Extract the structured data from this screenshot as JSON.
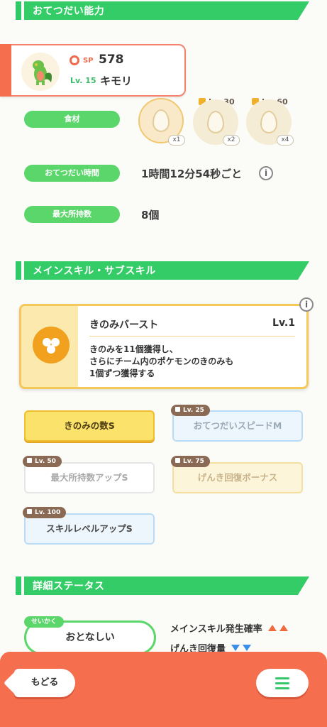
{
  "sections": {
    "ability": "おてつだい能力",
    "skills": "メインスキル・サブスキル",
    "details": "詳細ステータス"
  },
  "pokemon": {
    "sp_label": "SP",
    "sp_value": "578",
    "level": "Lv. 15",
    "name": "キモリ"
  },
  "ability_rows": {
    "ingredients_label": "食材",
    "help_time_label": "おてつだい時間",
    "help_time_value": "1時間12分54秒ごと",
    "max_carry_label": "最大所持数",
    "max_carry_value": "8個"
  },
  "ingredients": [
    {
      "qty": "x1",
      "unlock": ""
    },
    {
      "qty": "x2",
      "unlock": "Lv. 30"
    },
    {
      "qty": "x4",
      "unlock": "Lv. 60"
    }
  ],
  "main_skill": {
    "name": "きのみバースト",
    "level": "Lv.1",
    "desc1": "きのみを11個獲得し、",
    "desc2": "さらにチーム内のポケモンのきのみも",
    "desc3": "1個ずつ獲得する"
  },
  "sub_skills": [
    {
      "label": "きのみの数S",
      "lock": ""
    },
    {
      "label": "おてつだいスピードM",
      "lock": "Lv. 25"
    },
    {
      "label": "最大所持数アップS",
      "lock": "Lv. 50"
    },
    {
      "label": "げんき回復ボーナス",
      "lock": "Lv. 75"
    },
    {
      "label": "スキルレベルアップS",
      "lock": "Lv. 100"
    }
  ],
  "nature": {
    "tag": "せいかく",
    "value": "おとなしい",
    "stat_up": "メインスキル発生確率",
    "stat_down": "げんき回復量"
  },
  "footer": {
    "back_label": "もどる"
  },
  "colors": {
    "accent_green": "#33cc66",
    "accent_orange": "#f56f4f",
    "skill_gold": "#f4c95a"
  }
}
